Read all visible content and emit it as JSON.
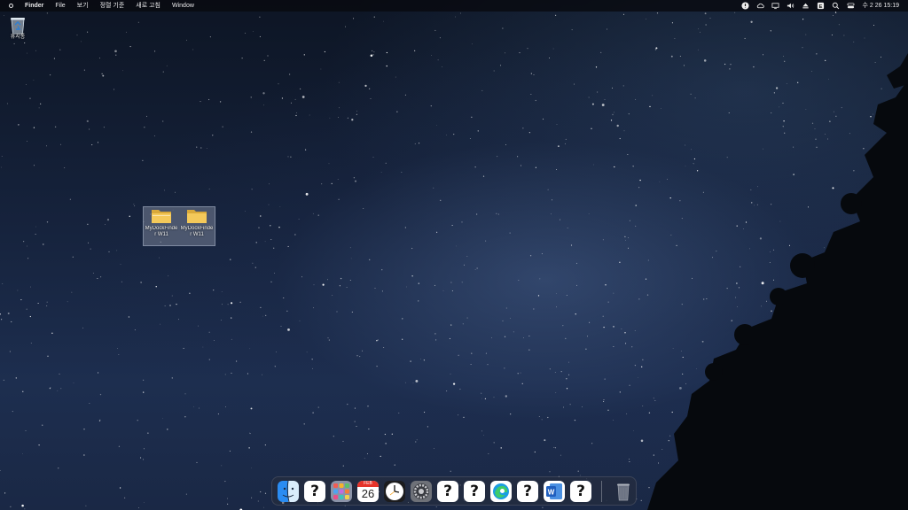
{
  "menubar": {
    "app_name": "Finder",
    "menus": [
      "File",
      "보기",
      "정렬 기준",
      "새로 고침",
      "Window"
    ],
    "tray_icons": [
      "notification-icon",
      "cloud-icon",
      "display-icon",
      "volume-icon",
      "eject-icon",
      "input-method-icon",
      "search-icon",
      "control-center-icon"
    ],
    "input_method": "E",
    "clock": "수 2 26 15:19"
  },
  "desktop": {
    "trash_label": "휴지통",
    "folders": [
      {
        "label": "MyDockFinder W11",
        "icon": "folder-icon"
      },
      {
        "label": "MyDockFinder W11",
        "icon": "folder-icon"
      }
    ]
  },
  "dock": {
    "items": [
      {
        "name": "finder",
        "icon": "finder-icon"
      },
      {
        "name": "unknown-app",
        "icon": "question-icon",
        "text": "?"
      },
      {
        "name": "launchpad",
        "icon": "launchpad-icon"
      },
      {
        "name": "calendar",
        "icon": "calendar-icon",
        "month": "FEB",
        "day": "26"
      },
      {
        "name": "clock",
        "icon": "clock-icon"
      },
      {
        "name": "system-settings",
        "icon": "gear-icon"
      },
      {
        "name": "unknown-app",
        "icon": "question-icon",
        "text": "?"
      },
      {
        "name": "unknown-app",
        "icon": "question-icon",
        "text": "?"
      },
      {
        "name": "edge",
        "icon": "edge-browser-icon"
      },
      {
        "name": "unknown-app",
        "icon": "question-icon",
        "text": "?"
      },
      {
        "name": "word",
        "icon": "word-icon",
        "text": "W"
      },
      {
        "name": "unknown-app",
        "icon": "question-icon",
        "text": "?"
      }
    ],
    "trash_icon": "trash-icon"
  }
}
